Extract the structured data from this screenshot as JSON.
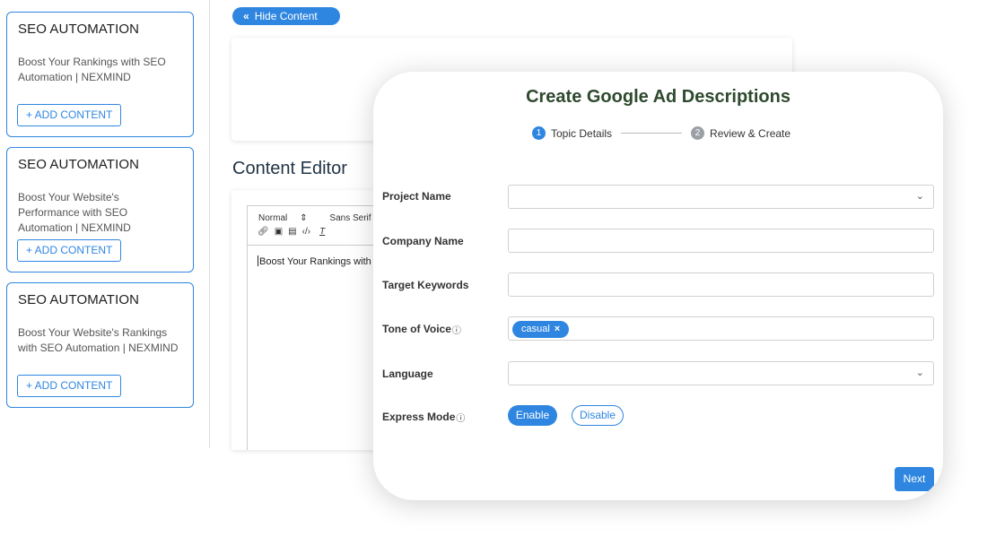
{
  "sidebar": {
    "cards": [
      {
        "title": "SEO AUTOMATION",
        "desc": "Boost Your Rankings with SEO Automation | NEXMIND",
        "button": "+ ADD CONTENT"
      },
      {
        "title": "SEO AUTOMATION",
        "desc": "Boost Your Website's Performance with SEO Automation | NEXMIND",
        "button": "+ ADD CONTENT"
      },
      {
        "title": "SEO AUTOMATION",
        "desc": "Boost Your Website's Rankings with SEO Automation | NEXMIND",
        "button": "+ ADD CONTENT"
      }
    ]
  },
  "main": {
    "hide_content_label": "Hide Content",
    "editor_title": "Content Editor",
    "toolbar": {
      "format": "Normal",
      "font": "Sans Serif"
    },
    "editor_text": "Boost Your Rankings with S"
  },
  "modal": {
    "title": "Create Google Ad Descriptions",
    "steps": [
      {
        "num": "1",
        "label": "Topic Details",
        "active": true
      },
      {
        "num": "2",
        "label": "Review & Create",
        "active": false
      }
    ],
    "fields": {
      "project_name": {
        "label": "Project Name",
        "value": ""
      },
      "company_name": {
        "label": "Company Name",
        "value": ""
      },
      "target_keywords": {
        "label": "Target Keywords",
        "value": ""
      },
      "tone_of_voice": {
        "label": "Tone of Voice",
        "tag": "casual"
      },
      "language": {
        "label": "Language",
        "value": ""
      },
      "express_mode": {
        "label": "Express Mode",
        "enable": "Enable",
        "disable": "Disable",
        "selected": "Enable"
      }
    },
    "next_label": "Next"
  },
  "colors": {
    "accent": "#2f86e0",
    "title": "#2e4a2e"
  }
}
